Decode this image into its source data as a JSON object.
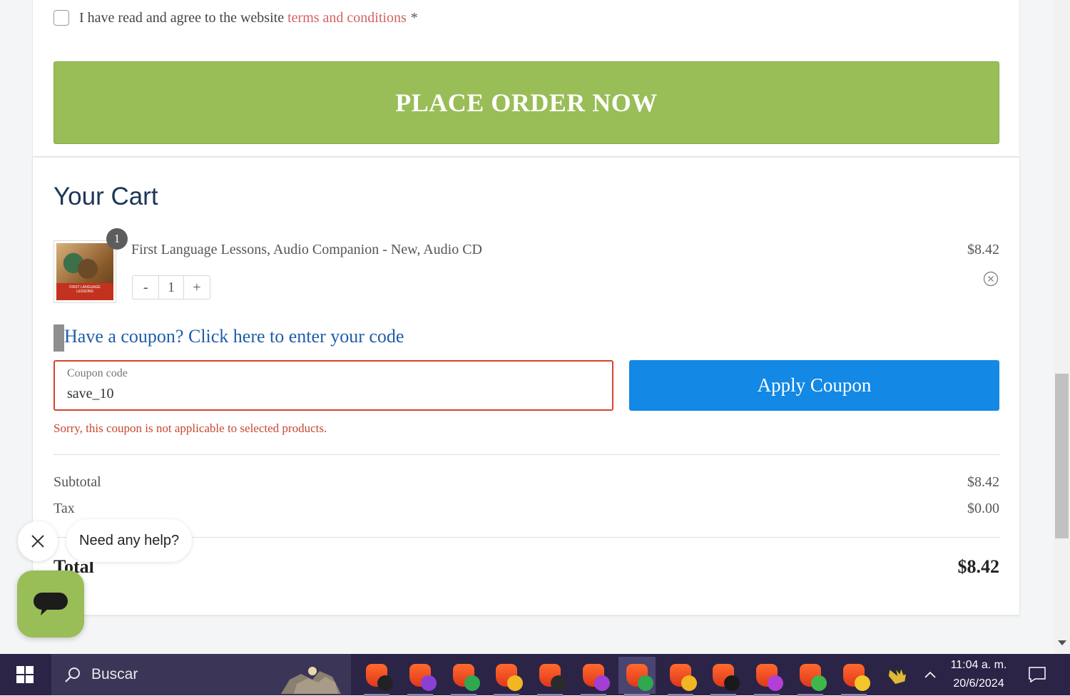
{
  "checkout": {
    "terms_text": "I have read and agree to the website",
    "terms_link": "terms and conditions",
    "required_mark": "*",
    "place_order_label": "PLACE ORDER NOW"
  },
  "cart": {
    "title": "Your Cart",
    "items": [
      {
        "name": "First Language Lessons, Audio Companion - New, Audio CD",
        "price": "$8.42",
        "quantity": "1",
        "badge": "1",
        "thumb_caption": "FIRST LANGUAGE LESSONS"
      }
    ],
    "stepper_minus": "-",
    "stepper_plus": "+"
  },
  "coupon": {
    "toggle_text": "Have a coupon? Click here to enter your code",
    "field_label": "Coupon code",
    "value": "save_10",
    "apply_label": "Apply Coupon",
    "error": "Sorry, this coupon is not applicable to selected products."
  },
  "summary": {
    "subtotal_label": "Subtotal",
    "subtotal_value": "$8.42",
    "tax_label": "Tax",
    "tax_value": "$0.00",
    "total_label": "Total",
    "total_value": "$8.42"
  },
  "help_widget": {
    "bubble_text": "Need any help?"
  },
  "taskbar": {
    "search_placeholder": "Buscar",
    "time": "11:04 a. m.",
    "date": "20/6/2024",
    "apps": [
      {
        "name": "brave-profile-1",
        "accent": "#222222"
      },
      {
        "name": "brave-profile-2",
        "accent": "#8c3fd6"
      },
      {
        "name": "brave-profile-3",
        "accent": "#2fa84f"
      },
      {
        "name": "brave-profile-4",
        "accent": "#f3b623"
      },
      {
        "name": "brave-profile-5",
        "accent": "#2b2b2b"
      },
      {
        "name": "brave-profile-6",
        "accent": "#a13fd6"
      },
      {
        "name": "brave-profile-7",
        "accent": "#2fa84f"
      },
      {
        "name": "brave-profile-8",
        "accent": "#f3b623"
      },
      {
        "name": "brave-profile-9",
        "accent": "#1a1a1a"
      },
      {
        "name": "brave-profile-10",
        "accent": "#b33fd6"
      },
      {
        "name": "brave-profile-11",
        "accent": "#3fb84a"
      },
      {
        "name": "brave-profile-12",
        "accent": "#f5c62a"
      }
    ]
  },
  "colors": {
    "place_order": "#99bd57",
    "apply_button": "#1388e4",
    "error": "#c8472f",
    "link": "#1f5ea8",
    "terms_link": "#d36262"
  }
}
